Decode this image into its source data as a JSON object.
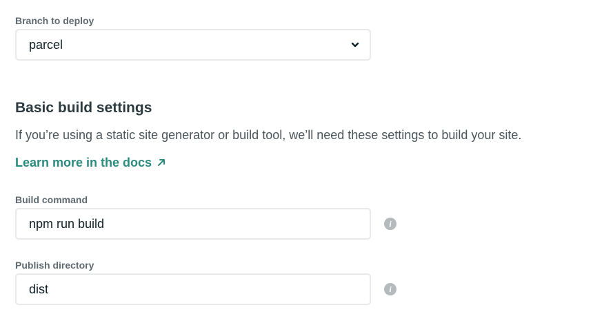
{
  "branch": {
    "label": "Branch to deploy",
    "selected": "parcel",
    "chevron_icon": "chevron-down-icon"
  },
  "build_settings": {
    "title": "Basic build settings",
    "description": "If you’re using a static site generator or build tool, we’ll need these settings to build your site.",
    "docs_link": "Learn more in the docs",
    "docs_link_icon": "external-arrow-icon",
    "link_color": "#2a8b7f"
  },
  "build_command": {
    "label": "Build command",
    "value": "npm run build",
    "info_icon": "info-icon"
  },
  "publish_directory": {
    "label": "Publish directory",
    "value": "dist",
    "info_icon": "info-icon"
  }
}
